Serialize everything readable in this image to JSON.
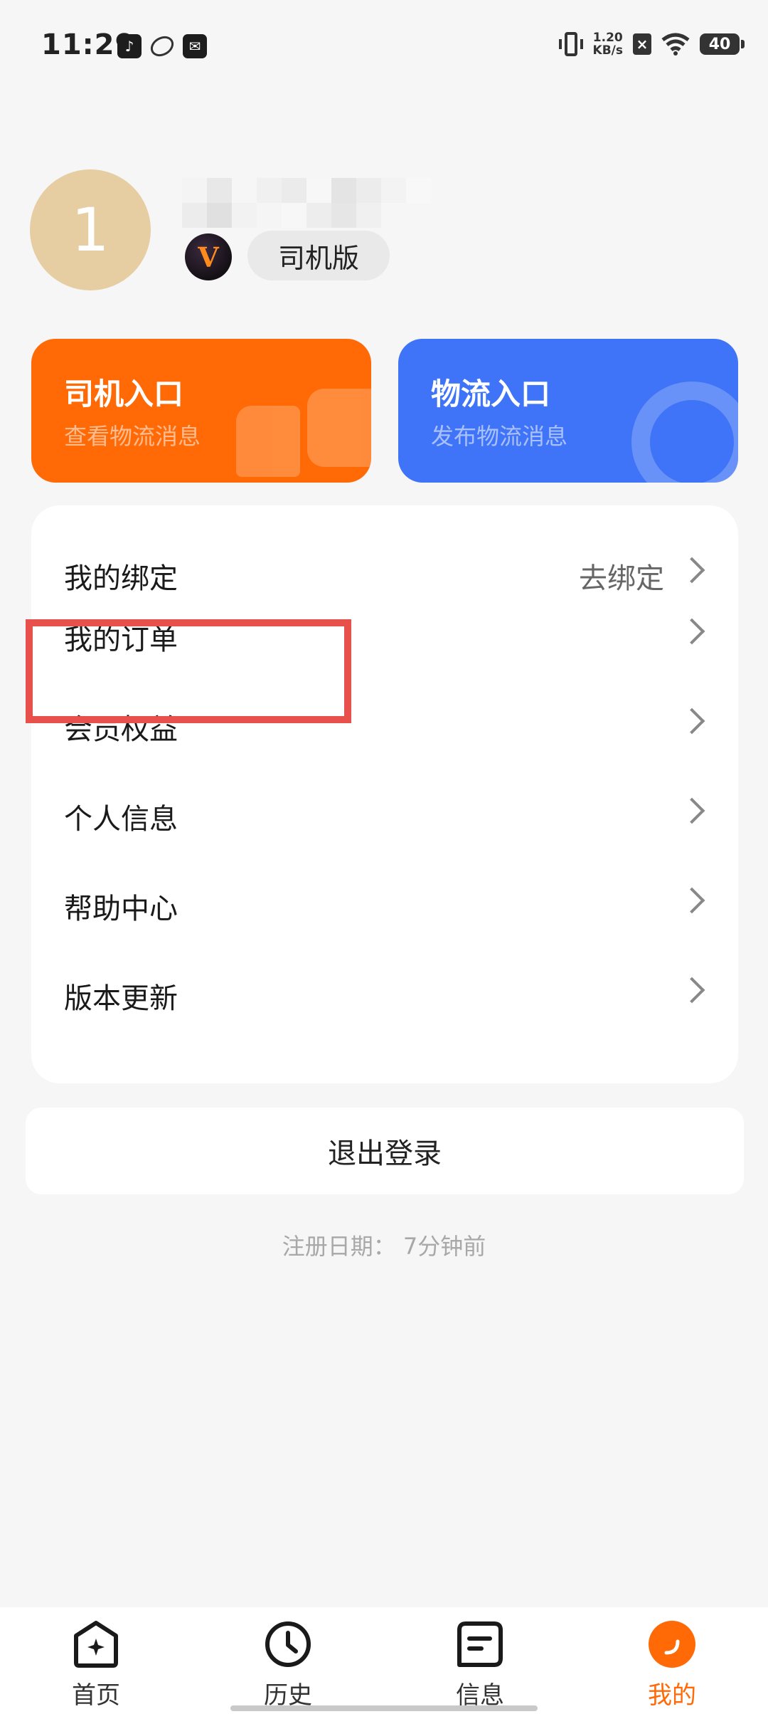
{
  "status_bar": {
    "time": "11:29",
    "net_speed_value": "1.20",
    "net_speed_unit": "KB/s",
    "battery": "40"
  },
  "profile": {
    "avatar_text": "1",
    "version_tag": "司机版",
    "vip_badge": "V"
  },
  "entries": [
    {
      "title": "司机入口",
      "subtitle": "查看物流消息",
      "color": "#ff6a06"
    },
    {
      "title": "物流入口",
      "subtitle": "发布物流消息",
      "color": "#3f74f8"
    }
  ],
  "menu": {
    "items": [
      {
        "label": "我的绑定",
        "value": "去绑定"
      },
      {
        "label": "我的订单"
      },
      {
        "label": "会员权益"
      },
      {
        "label": "个人信息"
      },
      {
        "label": "帮助中心"
      },
      {
        "label": "版本更新"
      }
    ]
  },
  "logout_label": "退出登录",
  "register_date": "注册日期：  7分钟前",
  "tabs": [
    {
      "label": "首页",
      "icon": "home-icon"
    },
    {
      "label": "历史",
      "icon": "clock-icon"
    },
    {
      "label": "信息",
      "icon": "message-icon"
    },
    {
      "label": "我的",
      "icon": "profile-icon",
      "active": true
    }
  ],
  "colors": {
    "accent": "#ff6a06",
    "blue": "#3f74f8",
    "highlight": "#e8504c"
  }
}
